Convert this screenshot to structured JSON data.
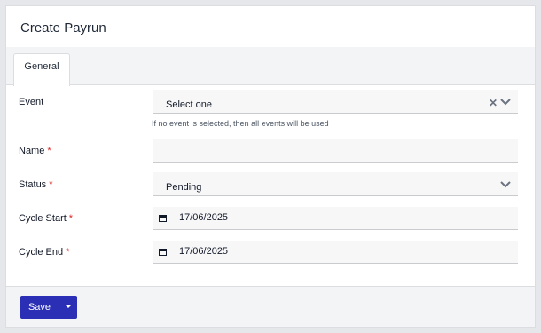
{
  "header": {
    "title": "Create Payrun"
  },
  "tabs": [
    {
      "label": "General"
    }
  ],
  "form": {
    "event": {
      "label": "Event",
      "value": "Select one",
      "hint": "If no event is selected, then all events will be used"
    },
    "name": {
      "label": "Name",
      "required": "*",
      "value": ""
    },
    "status": {
      "label": "Status",
      "required": "*",
      "value": "Pending"
    },
    "cycle_start": {
      "label": "Cycle Start",
      "required": "*",
      "value": "17/06/2025"
    },
    "cycle_end": {
      "label": "Cycle End",
      "required": "*",
      "value": "17/06/2025"
    }
  },
  "footer": {
    "save_label": "Save"
  },
  "icons": {
    "clear": "close-icon",
    "dropdown": "chevron-down-icon",
    "calendar": "calendar-icon",
    "save_menu": "caret-down-icon"
  },
  "colors": {
    "primary": "#2a2fb5",
    "required": "#dc2626",
    "background": "#e5e7eb"
  }
}
